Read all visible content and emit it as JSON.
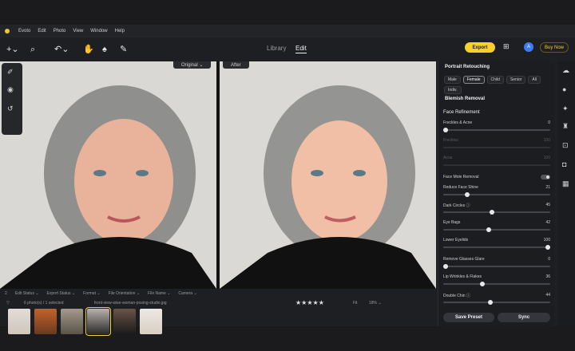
{
  "menu": {
    "items": [
      "Evoto",
      "Edit",
      "Photo",
      "View",
      "Window",
      "Help"
    ]
  },
  "toolbar": {
    "nav_library": "Library",
    "nav_edit": "Edit",
    "export_label": "Export",
    "avatar_initial": "A",
    "buy_now_label": "Buy Now"
  },
  "canvas": {
    "before_label": "Original ⌄",
    "after_label": "After"
  },
  "filmstrip": {
    "status_items": [
      "Edit Status ⌄",
      "Export Status ⌄",
      "Format ⌄",
      "File Orientation ⌄",
      "File Name ⌄",
      "Camera ⌄"
    ],
    "count_text": "6 photo(s) / 1 selected",
    "filename": "front-view-wise-woman-posing-studio.jpg",
    "rating": "★★★★★",
    "fit_label": "Fit",
    "zoom": "18% ⌄",
    "page_num": "2"
  },
  "panel": {
    "title": "Portrait Retouching",
    "chips": [
      "Male",
      "Female",
      "Child",
      "Senior",
      "All",
      "Indiv."
    ],
    "section": "Blemish Removal",
    "subsection": "Face Refinement",
    "rows": [
      {
        "label": "Freckles & Acne",
        "value": "0"
      },
      {
        "label": "Freckles",
        "value": "100"
      },
      {
        "label": "Acne",
        "value": "100"
      },
      {
        "label": "Face Mole Removal",
        "value": ""
      },
      {
        "label": "Reduce Face Shine",
        "value": "21"
      },
      {
        "label": "Dark Circles ⓘ",
        "value": "45"
      },
      {
        "label": "Eye Bags",
        "value": "42"
      },
      {
        "label": "Lower Eyelids",
        "value": "100"
      },
      {
        "label": "Remove Glasses Glare",
        "value": "0"
      },
      {
        "label": "Lip Wrinkles & Flakes",
        "value": "36"
      },
      {
        "label": "Double Chin ⓘ",
        "value": "44"
      }
    ],
    "levels": [
      0,
      100,
      100,
      0,
      21,
      45,
      42,
      100,
      0,
      36,
      44
    ],
    "save_preset": "Save Preset",
    "sync": "Sync"
  }
}
